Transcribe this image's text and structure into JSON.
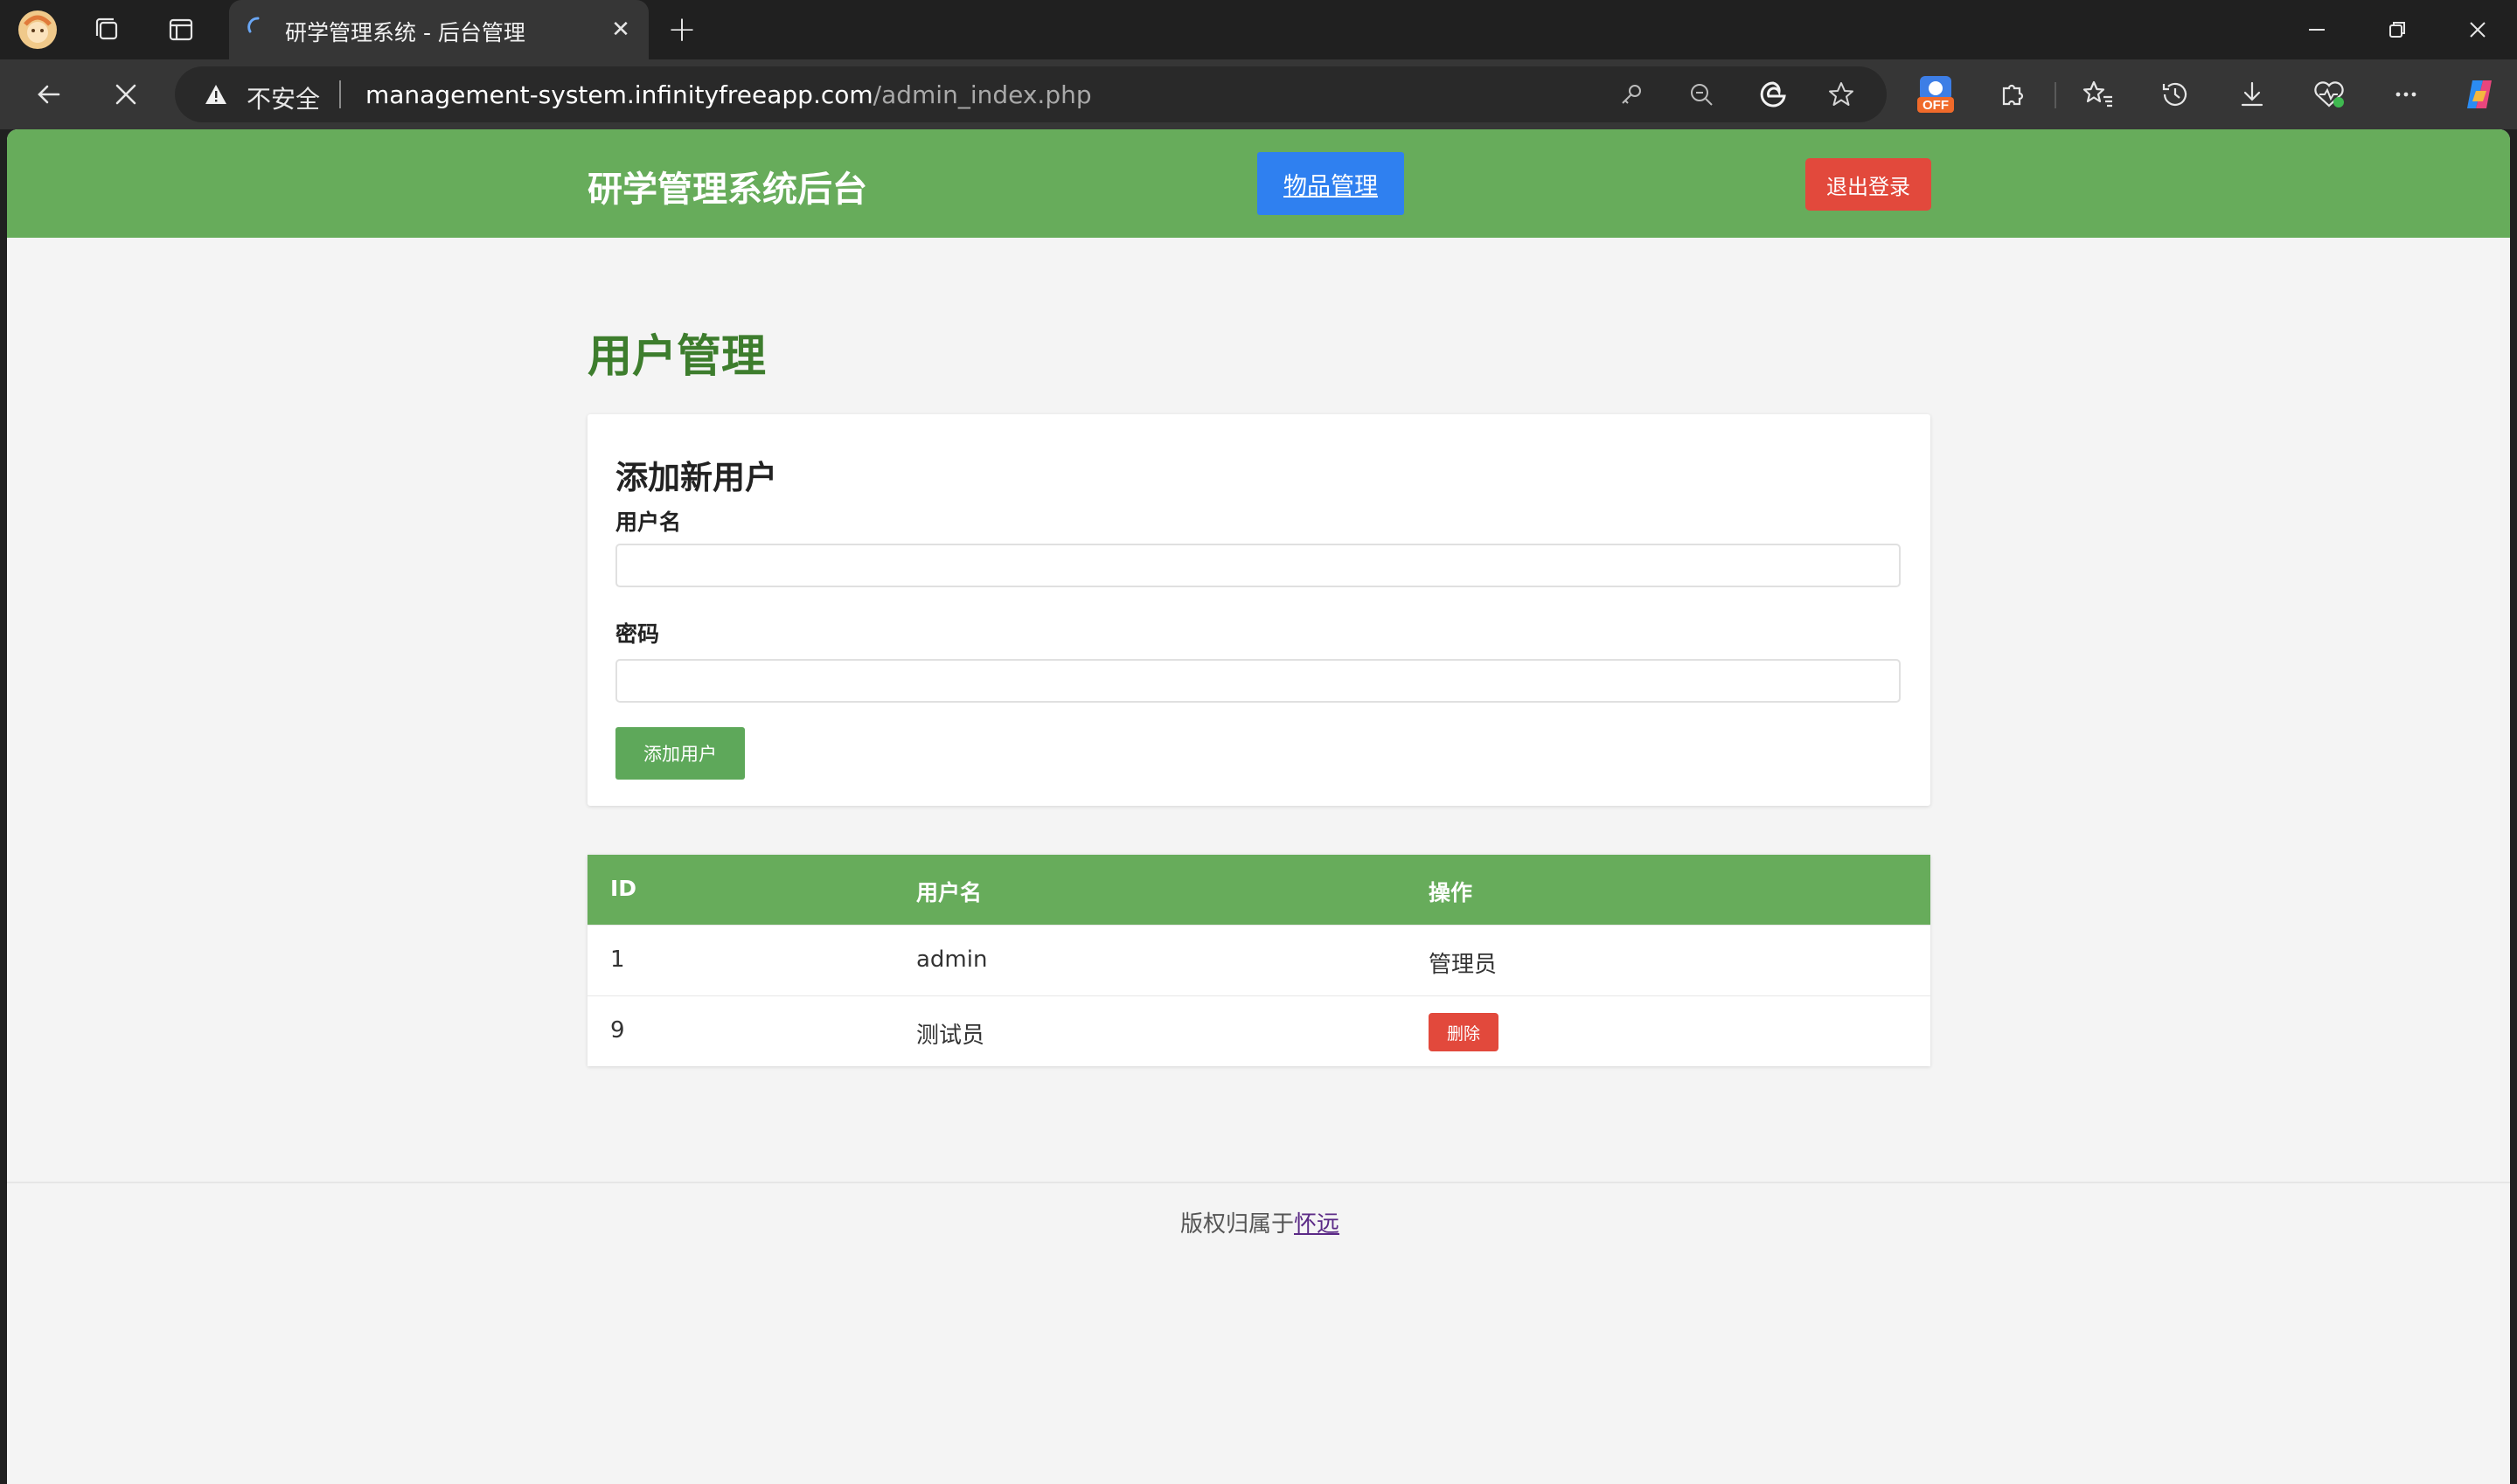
{
  "browser": {
    "tab_title": "研学管理系统 - 后台管理",
    "security_label": "不安全",
    "url_host": "management-system.infinityfreeapp.com",
    "url_path": "/admin_index.php",
    "extension_badge": "OFF"
  },
  "header": {
    "site_title": "研学管理系统后台",
    "nav_items_label": "物品管理",
    "logout_label": "退出登录"
  },
  "main": {
    "page_title": "用户管理",
    "add_form": {
      "title": "添加新用户",
      "username_label": "用户名",
      "username_value": "",
      "password_label": "密码",
      "password_value": "",
      "submit_label": "添加用户"
    },
    "table": {
      "headers": [
        "ID",
        "用户名",
        "操作"
      ],
      "rows": [
        {
          "id": "1",
          "username": "admin",
          "action": "管理员"
        },
        {
          "id": "9",
          "username": "测试员",
          "action": "删除"
        }
      ]
    }
  },
  "footer": {
    "text": "版权归属于",
    "link_text": "怀远"
  },
  "colors": {
    "header_green": "#67ac5b",
    "title_green": "#3d7d2d",
    "nav_blue": "#2f80f0",
    "danger_red": "#e2493c"
  }
}
